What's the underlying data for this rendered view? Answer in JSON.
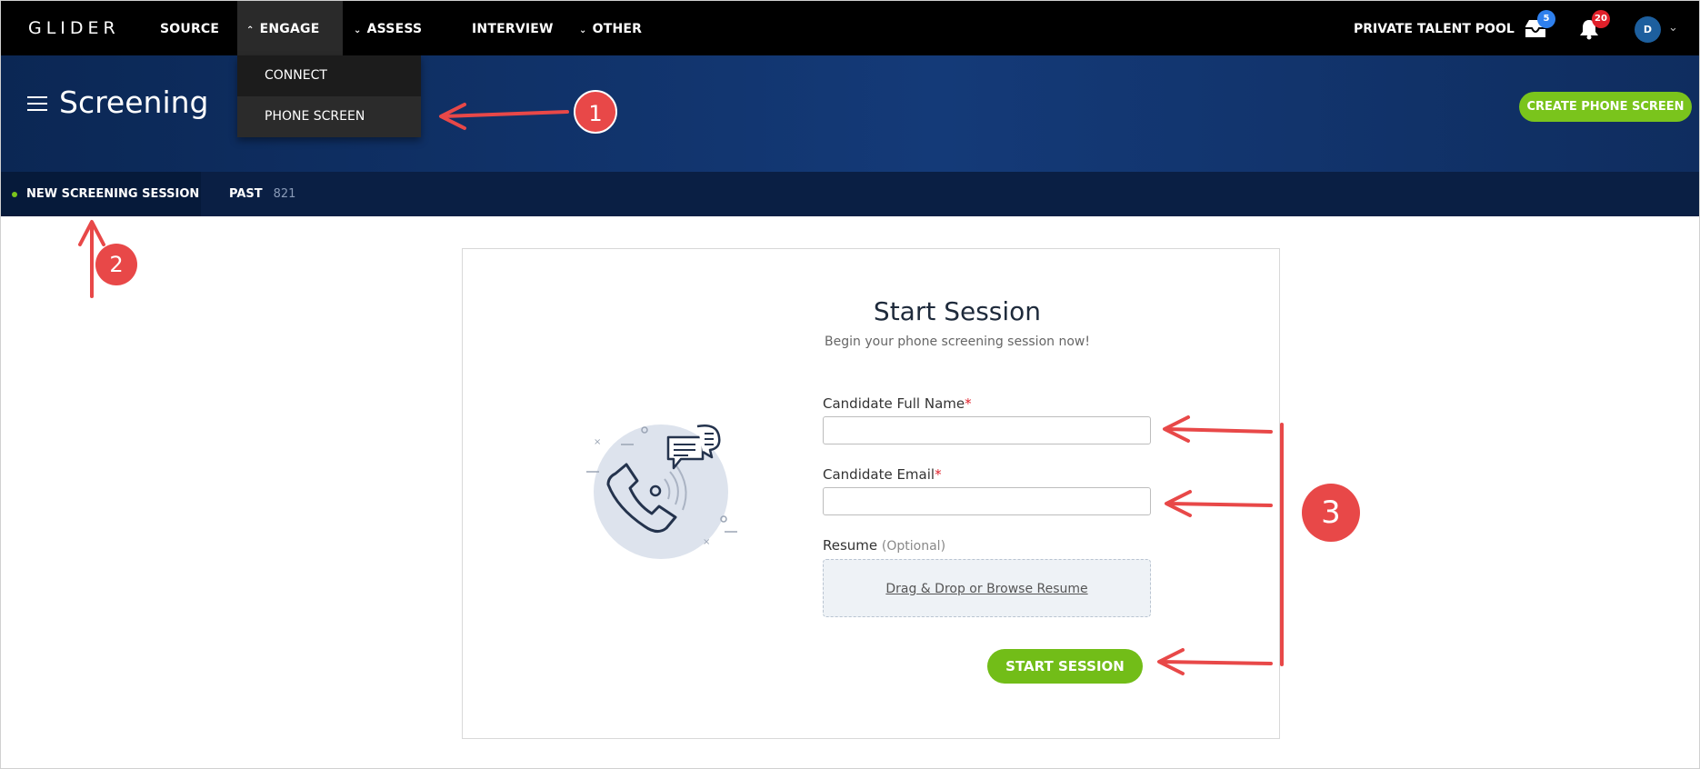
{
  "brand": "GLIDER",
  "nav": {
    "items": [
      {
        "label": "SOURCE",
        "chevron": ""
      },
      {
        "label": "ENGAGE",
        "chevron": "^"
      },
      {
        "label": "ASSESS",
        "chevron": "v"
      },
      {
        "label": "INTERVIEW",
        "chevron": ""
      },
      {
        "label": "OTHER",
        "chevron": "v"
      }
    ],
    "right_label": "PRIVATE TALENT POOL",
    "inbox_badge": "5",
    "notifications_badge": "20",
    "avatar_initial": "D"
  },
  "dropdown": {
    "items": [
      "CONNECT",
      "PHONE SCREEN"
    ],
    "active": "PHONE SCREEN"
  },
  "banner": {
    "title": "Screening",
    "create_button": "CREATE PHONE SCREEN"
  },
  "tabs": {
    "new_session": "NEW SCREENING SESSION",
    "past": "PAST",
    "past_count": "821"
  },
  "form": {
    "title": "Start Session",
    "subtitle": "Begin your phone screening session now!",
    "name_label": "Candidate Full Name",
    "email_label": "Candidate Email",
    "required_mark": "*",
    "resume_label": "Resume",
    "resume_optional": "(Optional)",
    "dropzone_text": "Drag & Drop or Browse Resume",
    "start_button": "START SESSION"
  },
  "annotations": {
    "markers": [
      "1",
      "2",
      "3"
    ],
    "color": "#e84848"
  },
  "colors": {
    "accent_green": "#7ac41c",
    "nav_bg": "#000000",
    "banner_bg": "#143a78"
  }
}
